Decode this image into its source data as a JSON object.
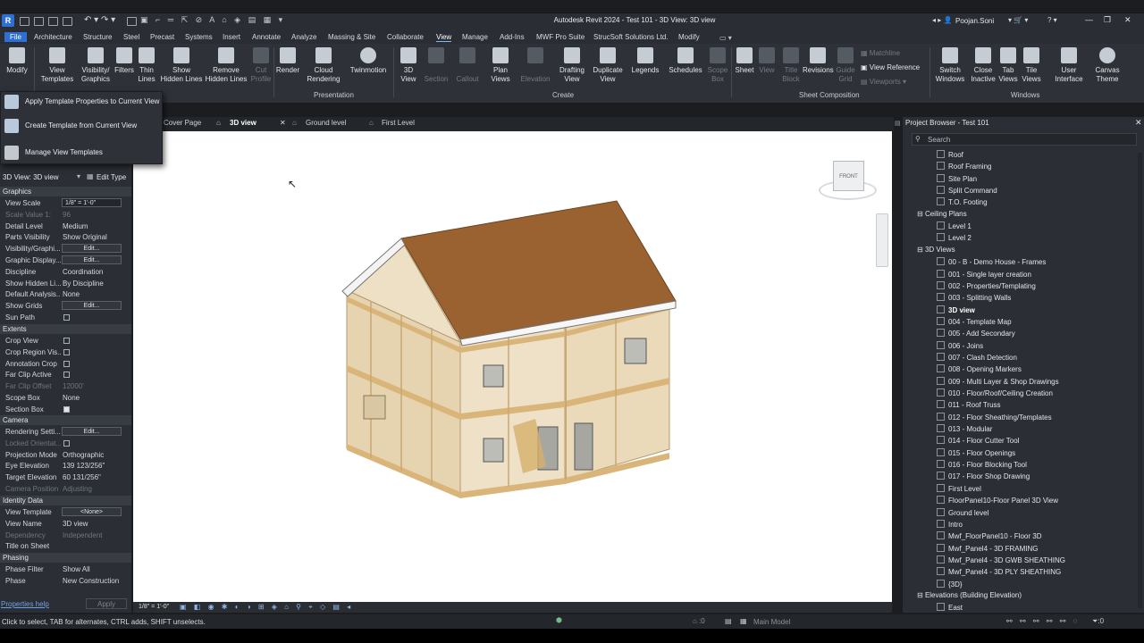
{
  "app": {
    "title": "Autodesk Revit 2024 - Test 101 - 3D View: 3D view",
    "user": "Poojan.Soni",
    "logo": "R"
  },
  "menu": [
    "File",
    "Architecture",
    "Structure",
    "Steel",
    "Precast",
    "Systems",
    "Insert",
    "Annotate",
    "Analyze",
    "Massing & Site",
    "Collaborate",
    "View",
    "Manage",
    "Add-Ins",
    "MWF Pro Suite",
    "StrucSoft Solutions Ltd.",
    "Modify"
  ],
  "ribbon": {
    "modify": "Modify",
    "view_templates": [
      "View",
      "Templates"
    ],
    "vis_graphics": [
      "Visibility/",
      "Graphics"
    ],
    "filters": "Filters",
    "thin_lines": [
      "Thin",
      "Lines"
    ],
    "show_hidden": [
      "Show",
      "Hidden Lines"
    ],
    "remove_hidden": [
      "Remove",
      "Hidden Lines"
    ],
    "cut_profile": [
      "Cut",
      "Profile"
    ],
    "render": "Render",
    "cloud_rendering": [
      "Cloud",
      "Rendering"
    ],
    "twinmotion": "Twinmotion",
    "view_3d": [
      "3D",
      "View"
    ],
    "section": "Section",
    "callout": "Callout",
    "plan_views": [
      "Plan",
      "Views"
    ],
    "elevation": "Elevation",
    "drafting_view": [
      "Drafting",
      "View"
    ],
    "duplicate_view": [
      "Duplicate",
      "View"
    ],
    "legends": "Legends",
    "schedules": "Schedules",
    "scope_box": [
      "Scope",
      "Box"
    ],
    "sheet": "Sheet",
    "view": "View",
    "title_block": [
      "Title",
      "Block"
    ],
    "revisions": "Revisions",
    "guide_grid": [
      "Guide",
      "Grid"
    ],
    "matchline": "Matchline",
    "view_reference": "View  Reference",
    "viewports": "Viewports",
    "switch_windows": [
      "Switch",
      "Windows"
    ],
    "close_inactive": [
      "Close",
      "Inactive"
    ],
    "tab_views": [
      "Tab",
      "Views"
    ],
    "tile_views": [
      "Tile",
      "Views"
    ],
    "user_interface": [
      "User",
      "Interface"
    ],
    "canvas_theme": [
      "Canvas",
      "Theme"
    ],
    "groups": {
      "presentation": "Presentation",
      "create": "Create",
      "sheet_composition": "Sheet Composition",
      "windows": "Windows"
    }
  },
  "dropdown": [
    "Apply Template Properties to Current View",
    "Create Template from Current View",
    "Manage View Templates"
  ],
  "doc_tabs": [
    "Cover Page",
    "3D view",
    "Ground level",
    "First Level"
  ],
  "properties": {
    "type_selector": "3D View: 3D view",
    "edit_type": "Edit Type",
    "sections": {
      "graphics": "Graphics",
      "extents": "Extents",
      "camera": "Camera",
      "identity": "Identity Data",
      "phasing": "Phasing"
    },
    "graphics": [
      {
        "k": "View Scale",
        "v": "1/8\" = 1'-0\"",
        "box": true
      },
      {
        "k": "Scale Value    1:",
        "v": "96",
        "dis": true
      },
      {
        "k": "Detail Level",
        "v": "Medium"
      },
      {
        "k": "Parts Visibility",
        "v": "Show Original"
      },
      {
        "k": "Visibility/Graphi...",
        "v": "Edit...",
        "btn": true
      },
      {
        "k": "Graphic Display...",
        "v": "Edit...",
        "btn": true
      },
      {
        "k": "Discipline",
        "v": "Coordination"
      },
      {
        "k": "Show Hidden Li...",
        "v": "By Discipline"
      },
      {
        "k": "Default Analysis...",
        "v": "None"
      },
      {
        "k": "Show Grids",
        "v": "Edit...",
        "btn": true
      },
      {
        "k": "Sun Path",
        "v": "",
        "chk": false
      }
    ],
    "extents": [
      {
        "k": "Crop View",
        "chk": false
      },
      {
        "k": "Crop Region Vis...",
        "chk": false
      },
      {
        "k": "Annotation Crop",
        "chk": false
      },
      {
        "k": "Far Clip Active",
        "chk": false
      },
      {
        "k": "Far Clip Offset",
        "v": "12000'",
        "dis": true
      },
      {
        "k": "Scope Box",
        "v": "None"
      },
      {
        "k": "Section Box",
        "chk": true
      }
    ],
    "camera": [
      {
        "k": "Rendering Setti...",
        "v": "Edit...",
        "btn": true
      },
      {
        "k": "Locked Orientat...",
        "chk": false,
        "dis": true
      },
      {
        "k": "Projection Mode",
        "v": "Orthographic"
      },
      {
        "k": "Eye Elevation",
        "v": "139 123/256\""
      },
      {
        "k": "Target Elevation",
        "v": "60 131/256\""
      },
      {
        "k": "Camera Position",
        "v": "Adjusting",
        "dis": true
      }
    ],
    "identity": [
      {
        "k": "View Template",
        "v": "<None>",
        "btn": true
      },
      {
        "k": "View Name",
        "v": "3D view"
      },
      {
        "k": "Dependency",
        "v": "Independent",
        "dis": true
      },
      {
        "k": "Title on Sheet",
        "v": ""
      }
    ],
    "phasing": [
      {
        "k": "Phase Filter",
        "v": "Show All"
      },
      {
        "k": "Phase",
        "v": "New Construction"
      }
    ],
    "help": "Properties help",
    "apply": "Apply"
  },
  "browser": {
    "title": "Project Browser - Test 101",
    "search": "Search",
    "floor_items": [
      "Roof",
      "Roof Framing",
      "Site Plan",
      "Split Command",
      "T.O. Footing"
    ],
    "ceiling_head": "Ceiling Plans",
    "ceiling_items": [
      "Level 1",
      "Level 2"
    ],
    "views3d_head": "3D Views",
    "views3d_items": [
      "00 - B - Demo House - Frames",
      "001 - Single layer creation",
      "002 - Properties/Templating",
      "003 - Splitting Walls",
      "3D view",
      "004 - Template Map",
      "005 - Add Secondary",
      "006 - Joins",
      "007 - Clash Detection",
      "008 - Opening Markers",
      "009 - Multi Layer & Shop Drawings",
      "010 - Floor/Roof/Ceiling Creation",
      "011 - Roof Truss",
      "012 - Floor Sheathing/Templates",
      "013 - Modular",
      "014 - Floor Cutter Tool",
      "015 - Floor Openings",
      "016 - Floor Blocking Tool",
      "017 - Floor Shop Drawing",
      "First Level",
      "FloorPanel10-Floor Panel 3D View",
      "Ground level",
      "Intro",
      "Mwf_FloorPanel10 - Floor 3D",
      "Mwf_Panel4 - 3D FRAMING",
      "Mwf_Panel4 - 3D GWB SHEATHING",
      "Mwf_Panel4 - 3D PLY SHEATHING",
      "{3D}"
    ],
    "elev_head": "Elevations (Building Elevation)",
    "elev_items": [
      "East"
    ]
  },
  "viewcube": "FRONT",
  "view_scale_bar": "1/8\" = 1'-0\"",
  "status": {
    "hint": "Click to select, TAB for alternates, CTRL adds, SHIFT unselects.",
    "model": "Main Model",
    "filter_count": ":0",
    "count": ":0"
  },
  "colors": {
    "accent": "#2d6fd2",
    "roof": "#9a6230",
    "wall": "#e7d4ad",
    "timber": "#d9b57a"
  }
}
